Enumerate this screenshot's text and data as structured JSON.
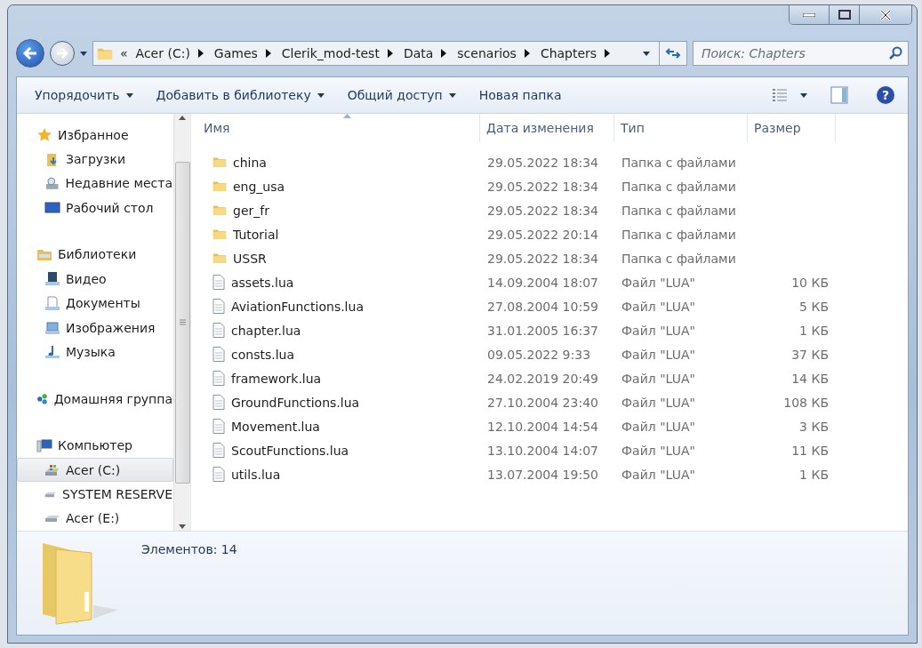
{
  "address": {
    "overflow": "«",
    "crumbs": [
      "Acer (C:)",
      "Games",
      "Clerik_mod-test",
      "Data",
      "scenarios",
      "Chapters"
    ]
  },
  "search": {
    "placeholder": "Поиск: Chapters"
  },
  "toolbar": [
    {
      "label": "Упорядочить",
      "dropdown": true
    },
    {
      "label": "Добавить в библиотеку",
      "dropdown": true
    },
    {
      "label": "Общий доступ",
      "dropdown": true
    },
    {
      "label": "Новая папка",
      "dropdown": false
    }
  ],
  "sidebar": {
    "groups": [
      {
        "label": "Избранное",
        "kind": "star",
        "children": [
          {
            "label": "Загрузки",
            "kind": "downloads",
            "selected": false
          },
          {
            "label": "Недавние места",
            "kind": "recent",
            "selected": false
          },
          {
            "label": "Рабочий стол",
            "kind": "desktop",
            "selected": false
          }
        ]
      },
      {
        "label": "Библиотеки",
        "kind": "libraries",
        "children": [
          {
            "label": "Видео",
            "kind": "video",
            "selected": false
          },
          {
            "label": "Документы",
            "kind": "documents",
            "selected": false
          },
          {
            "label": "Изображения",
            "kind": "pictures",
            "selected": false
          },
          {
            "label": "Музыка",
            "kind": "music",
            "selected": false
          }
        ]
      },
      {
        "label": "Домашняя группа",
        "kind": "homegroup"
      },
      {
        "label": "Компьютер",
        "kind": "computer",
        "children": [
          {
            "label": "Acer (C:)",
            "kind": "sysdrive",
            "selected": true
          },
          {
            "label": "SYSTEM RESERVE",
            "kind": "drive",
            "selected": false
          },
          {
            "label": "Acer (E:)",
            "kind": "drive",
            "selected": false
          }
        ]
      }
    ]
  },
  "table": {
    "columns": [
      "Имя",
      "Дата изменения",
      "Тип",
      "Размер"
    ],
    "rows": [
      {
        "kind": "folder",
        "name": "china",
        "date": "29.05.2022 18:34",
        "type": "Папка с файлами"
      },
      {
        "kind": "folder",
        "name": "eng_usa",
        "date": "29.05.2022 18:34",
        "type": "Папка с файлами"
      },
      {
        "kind": "folder",
        "name": "ger_fr",
        "date": "29.05.2022 18:34",
        "type": "Папка с файлами"
      },
      {
        "kind": "folder",
        "name": "Tutorial",
        "date": "29.05.2022 20:14",
        "type": "Папка с файлами"
      },
      {
        "kind": "folder",
        "name": "USSR",
        "date": "29.05.2022 18:34",
        "type": "Папка с файлами"
      },
      {
        "kind": "file",
        "name": "assets.lua",
        "date": "14.09.2004 18:07",
        "type": "Файл \"LUA\"",
        "size": "10 КБ"
      },
      {
        "kind": "file",
        "name": "AviationFunctions.lua",
        "date": "27.08.2004 10:59",
        "type": "Файл \"LUA\"",
        "size": "5 КБ"
      },
      {
        "kind": "file",
        "name": "chapter.lua",
        "date": "31.01.2005 16:37",
        "type": "Файл \"LUA\"",
        "size": "1 КБ"
      },
      {
        "kind": "file",
        "name": "consts.lua",
        "date": "09.05.2022 9:33",
        "type": "Файл \"LUA\"",
        "size": "37 КБ"
      },
      {
        "kind": "file",
        "name": "framework.lua",
        "date": "24.02.2019 20:49",
        "type": "Файл \"LUA\"",
        "size": "14 КБ"
      },
      {
        "kind": "file",
        "name": "GroundFunctions.lua",
        "date": "27.10.2004 23:40",
        "type": "Файл \"LUA\"",
        "size": "108 КБ"
      },
      {
        "kind": "file",
        "name": "Movement.lua",
        "date": "12.10.2004 14:54",
        "type": "Файл \"LUA\"",
        "size": "3 КБ"
      },
      {
        "kind": "file",
        "name": "ScoutFunctions.lua",
        "date": "13.10.2004 14:07",
        "type": "Файл \"LUA\"",
        "size": "11 КБ"
      },
      {
        "kind": "file",
        "name": "utils.lua",
        "date": "13.07.2004 19:50",
        "type": "Файл \"LUA\"",
        "size": "1 КБ"
      }
    ]
  },
  "help": {
    "label": "?"
  },
  "details": {
    "count": "Элементов: 14"
  }
}
